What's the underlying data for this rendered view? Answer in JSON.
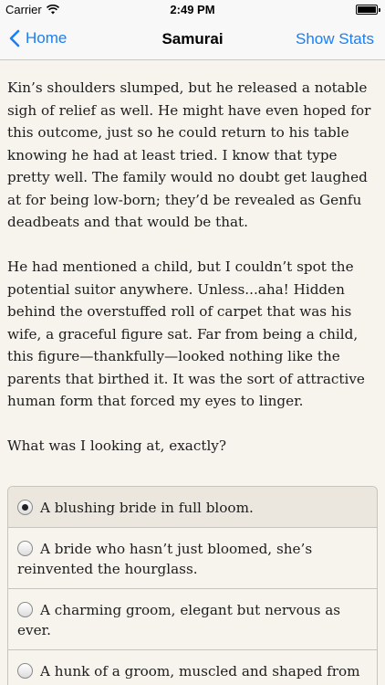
{
  "status_bar": {
    "carrier": "Carrier",
    "time": "2:49 PM"
  },
  "nav": {
    "back_label": "Home",
    "title": "Samurai",
    "stats_label": "Show Stats"
  },
  "story": {
    "paragraphs": [
      "Kin’s shoulders slumped, but he released a notable sigh of relief as well. He might have even hoped for this outcome, just so he could return to his table knowing he had at least tried. I know that type pretty well. The family would no doubt get laughed at for being low-born; they’d be revealed as Genfu deadbeats and that would be that.",
      "He had mentioned a child, but I couldn’t spot the potential suitor anywhere. Unless...aha! Hidden behind the overstuffed roll of carpet that was his wife, a graceful figure sat. Far from being a child, this figure—thankfully—looked nothing like the parents that birthed it. It was the sort of attractive human form that forced my eyes to linger.",
      "What was I looking at, exactly?"
    ]
  },
  "choices": [
    {
      "label": "A blushing bride in full bloom.",
      "selected": true
    },
    {
      "label": "A bride who hasn’t just bloomed, she’s reinvented the hourglass.",
      "selected": false
    },
    {
      "label": "A charming groom, elegant but nervous as ever.",
      "selected": false
    },
    {
      "label": "A hunk of a groom, muscled and shaped from top to bottom.",
      "selected": false
    }
  ],
  "colors": {
    "accent": "#1a7ff6",
    "background": "#f7f4ee"
  }
}
